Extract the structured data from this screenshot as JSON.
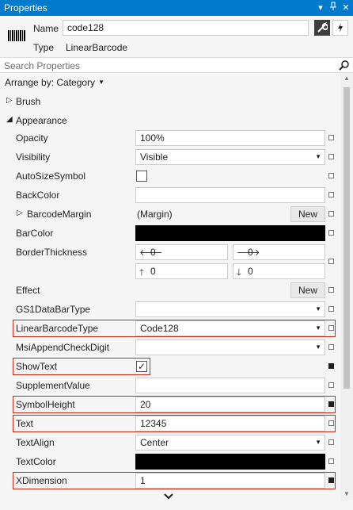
{
  "window": {
    "title": "Properties"
  },
  "header": {
    "name_label": "Name",
    "name_value": "code128",
    "type_label": "Type",
    "type_value": "LinearBarcode",
    "properties_icon": "wrench-icon",
    "events_icon": "lightning-icon"
  },
  "search": {
    "placeholder": "Search Properties"
  },
  "arrange": {
    "label": "Arrange by: Category"
  },
  "categories": {
    "brush": "Brush",
    "appearance": "Appearance"
  },
  "props": {
    "opacity": {
      "name": "Opacity",
      "value": "100%"
    },
    "visibility": {
      "name": "Visibility",
      "value": "Visible"
    },
    "autosizesymbol": {
      "name": "AutoSizeSymbol",
      "checked": false
    },
    "backcolor": {
      "name": "BackColor",
      "value": ""
    },
    "barcodemargin": {
      "name": "BarcodeMargin",
      "value": "(Margin)",
      "button": "New"
    },
    "barcolor": {
      "name": "BarColor",
      "color": "#000000"
    },
    "borderthickness": {
      "name": "BorderThickness",
      "left": "0",
      "right": "0",
      "top": "0",
      "bottom": "0"
    },
    "effect": {
      "name": "Effect",
      "button": "New"
    },
    "gs1databartype": {
      "name": "GS1DataBarType",
      "value": ""
    },
    "linearbarcodetype": {
      "name": "LinearBarcodeType",
      "value": "Code128"
    },
    "msiappendcheckdigit": {
      "name": "MsiAppendCheckDigit",
      "value": ""
    },
    "showtext": {
      "name": "ShowText",
      "checked": true,
      "check_mark": "✓"
    },
    "supplementvalue": {
      "name": "SupplementValue",
      "value": ""
    },
    "symbolheight": {
      "name": "SymbolHeight",
      "value": "20"
    },
    "text": {
      "name": "Text",
      "value": "12345"
    },
    "textalign": {
      "name": "TextAlign",
      "value": "Center"
    },
    "textcolor": {
      "name": "TextColor",
      "color": "#000000"
    },
    "xdimension": {
      "name": "XDimension",
      "value": "1"
    }
  },
  "colors": {
    "accent": "#007acc",
    "highlight_border": "#c42b1c"
  }
}
